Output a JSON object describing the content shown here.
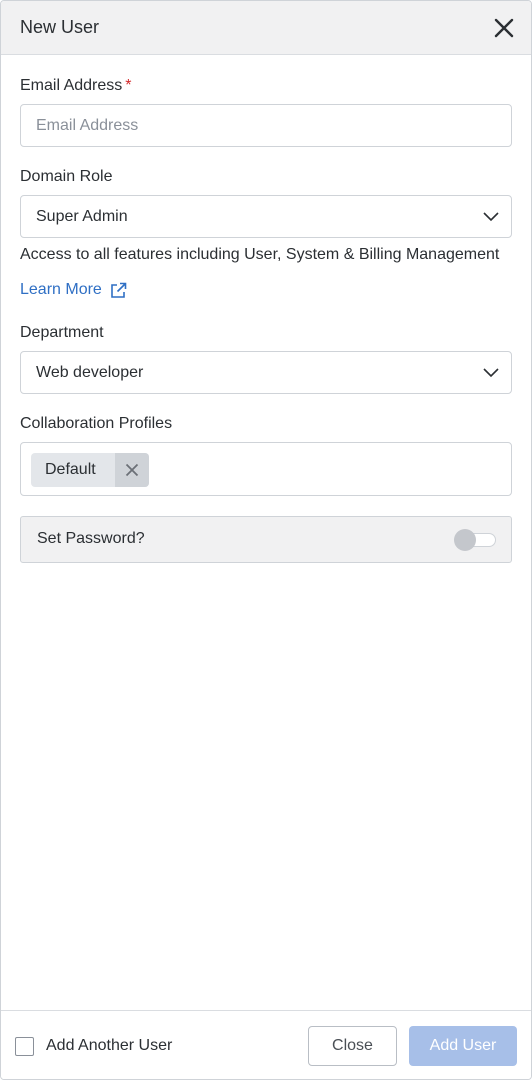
{
  "header": {
    "title": "New User"
  },
  "email": {
    "label": "Email Address",
    "required_mark": "*",
    "placeholder": "Email Address",
    "value": ""
  },
  "domain_role": {
    "label": "Domain Role",
    "selected": "Super Admin",
    "description": "Access to all features including User, System & Billing Management",
    "learn_more": "Learn More"
  },
  "department": {
    "label": "Department",
    "selected": "Web developer"
  },
  "collaboration_profiles": {
    "label": "Collaboration Profiles",
    "chips": [
      "Default"
    ]
  },
  "set_password": {
    "label": "Set Password?",
    "enabled": false
  },
  "footer": {
    "add_another_label": "Add Another User",
    "add_another_checked": false,
    "close_label": "Close",
    "add_user_label": "Add User"
  },
  "colors": {
    "link": "#2f6fc4",
    "required": "#d2282a",
    "primary_disabled": "#a7bfe8"
  }
}
